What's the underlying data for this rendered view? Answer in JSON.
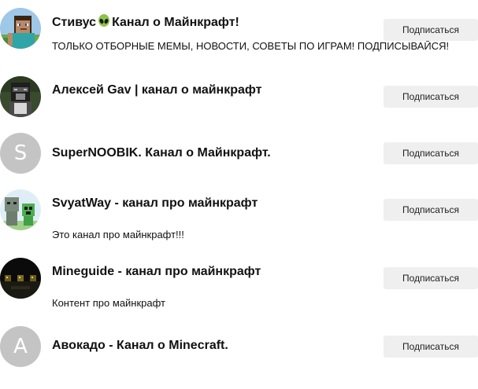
{
  "channels": [
    {
      "title_before_emoji": "Стивус",
      "title_after_emoji": "Канал о Майнкрафт!",
      "description": "ТОЛЬКО ОТБОРНЫЕ МЕМЫ, НОВОСТИ, СОВЕТЫ ПО ИГРАМ! ПОДПИСЫВАЙСЯ!",
      "subscribe_label": "Подписаться"
    },
    {
      "title": "Алексей Gav | канал о майнкрафт",
      "subscribe_label": "Подписаться"
    },
    {
      "title": "SuperNOOBIK. Канал о Майнкрафт.",
      "avatar_letter": "S",
      "subscribe_label": "Подписаться"
    },
    {
      "title": "SvyatWay - канал про майнкрафт",
      "description": "Это канал про майнкрафт!!!",
      "subscribe_label": "Подписаться"
    },
    {
      "title": "Mineguide - канал про майнкрафт",
      "description": "Контент про майнкрафт",
      "subscribe_label": "Подписаться"
    },
    {
      "title": "Авокадо - Канал о Minecraft.",
      "avatar_letter": "A",
      "subscribe_label": "Подписаться"
    }
  ],
  "colors": {
    "subscribe_bg": "#efefef",
    "letter_avatar_bg": "#c4c4c4"
  }
}
